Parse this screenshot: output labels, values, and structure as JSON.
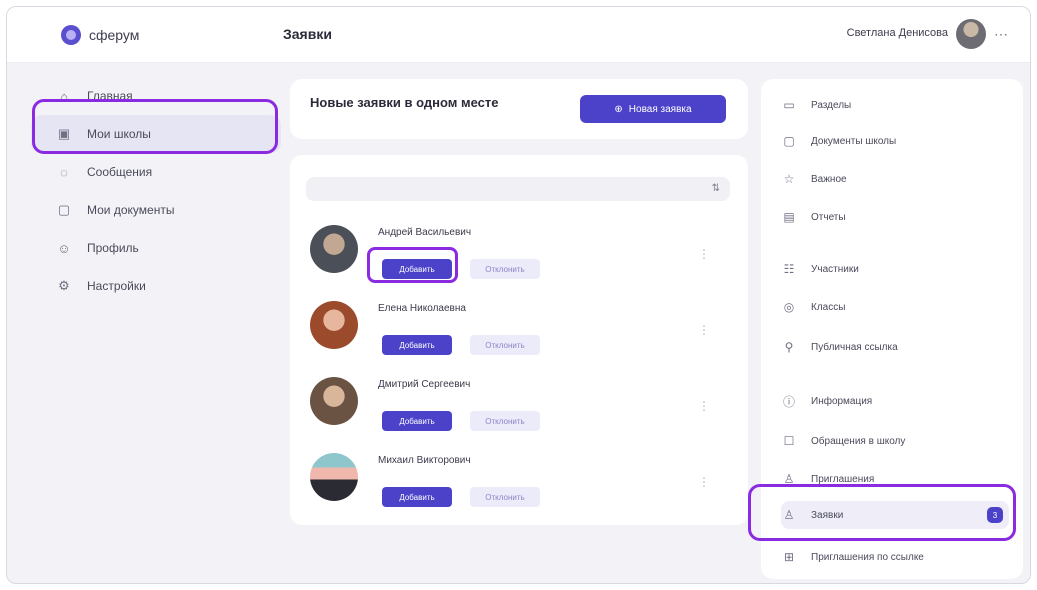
{
  "header": {
    "logo_text": "сферум",
    "page_title": "Заявки",
    "user_name": "Светлана Денисова",
    "user_role": "",
    "more_icon": "more-icon"
  },
  "sidebar": {
    "items": [
      {
        "label": "Главная",
        "icon": "home-icon"
      },
      {
        "label": "Мои школы",
        "icon": "school-icon"
      },
      {
        "label": "Сообщения",
        "icon": "chat-icon"
      },
      {
        "label": "Мои документы",
        "icon": "document-icon"
      },
      {
        "label": "Профиль",
        "icon": "profile-icon"
      },
      {
        "label": "Настройки",
        "icon": "settings-icon"
      }
    ],
    "footer_lines": [
      "",
      ""
    ]
  },
  "new_card": {
    "title": "Новые заявки в одном месте",
    "subtitle": "",
    "button_label": "Новая заявка"
  },
  "requests": {
    "count_label": "",
    "sort_label": "",
    "items": [
      {
        "name": "Андрей Васильевич",
        "desc": "",
        "accept": "Добавить",
        "decline": "Отклонить"
      },
      {
        "name": "Елена Николаевна",
        "desc": "",
        "accept": "Добавить",
        "decline": "Отклонить"
      },
      {
        "name": "Дмитрий Сергеевич",
        "desc": "",
        "accept": "Добавить",
        "decline": "Отклонить"
      },
      {
        "name": "Михаил Викторович",
        "desc": "",
        "accept": "Добавить",
        "decline": "Отклонить"
      }
    ]
  },
  "right_menu": {
    "items": [
      {
        "label": "Разделы",
        "icon": "calendar-icon"
      },
      {
        "label": "Документы школы",
        "icon": "folder-icon"
      },
      {
        "label": "Важное",
        "icon": "star-icon"
      },
      {
        "label": "Отчеты",
        "icon": "report-icon"
      },
      {
        "label": "Участники",
        "icon": "people-icon"
      },
      {
        "label": "Классы",
        "icon": "class-icon"
      },
      {
        "label": "Публичная ссылка",
        "icon": "link-icon"
      },
      {
        "label": "Информация",
        "icon": "info-icon"
      },
      {
        "label": "Обращения в школу",
        "icon": "mail-icon"
      },
      {
        "label": "Приглашения",
        "icon": "invite-icon"
      },
      {
        "label": "Заявки",
        "icon": "requests-icon",
        "badge": "3"
      },
      {
        "label": "Приглашения по ссылке",
        "icon": "link-invite-icon"
      }
    ]
  },
  "colors": {
    "accent": "#4b42c9",
    "highlight": "#8a2be2",
    "background": "#f3f3f7"
  }
}
